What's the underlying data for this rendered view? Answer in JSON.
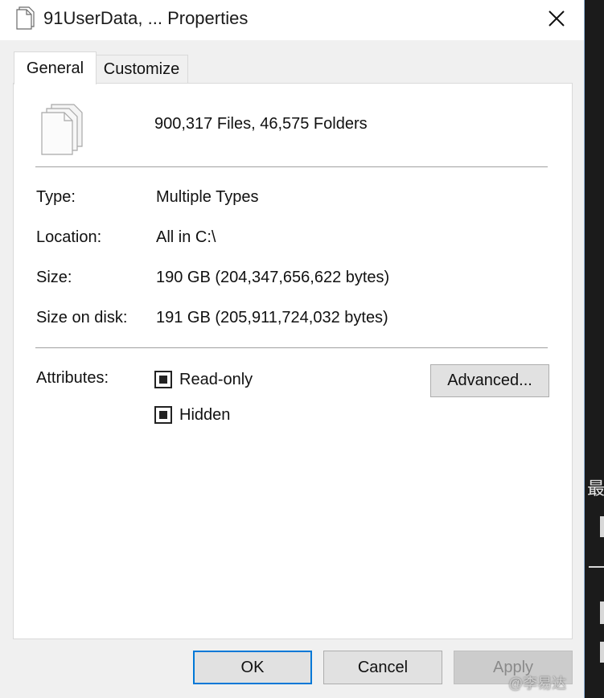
{
  "window": {
    "title": "91UserData, ... Properties",
    "close_icon": "close-icon"
  },
  "tabs": [
    {
      "label": "General",
      "active": true
    },
    {
      "label": "Customize",
      "active": false
    }
  ],
  "general": {
    "summary": "900,317 Files, 46,575 Folders",
    "rows": [
      {
        "label": "Type:",
        "value": "Multiple Types"
      },
      {
        "label": "Location:",
        "value": "All in C:\\"
      },
      {
        "label": "Size:",
        "value": "190 GB (204,347,656,622 bytes)"
      },
      {
        "label": "Size on disk:",
        "value": "191 GB (205,911,724,032 bytes)"
      }
    ],
    "attributes_label": "Attributes:",
    "attributes": [
      {
        "label": "Read-only",
        "state": "indeterminate"
      },
      {
        "label": "Hidden",
        "state": "indeterminate"
      }
    ],
    "advanced_button": "Advanced..."
  },
  "buttons": {
    "ok": "OK",
    "cancel": "Cancel",
    "apply": "Apply"
  },
  "background": {
    "glyph": "最"
  },
  "watermark": "@李易达",
  "colors": {
    "accent": "#0078d7",
    "window_bg": "#f0f0f0",
    "panel_bg": "#ffffff",
    "desktop_bg": "#1e1e1e"
  }
}
